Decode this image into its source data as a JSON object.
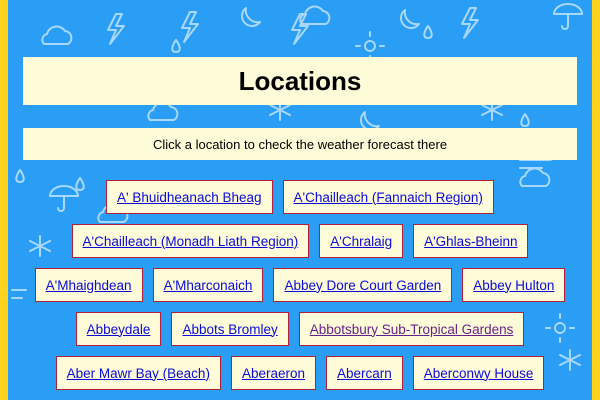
{
  "colors": {
    "background": "#2a9df4",
    "side_border": "#ffd21f",
    "panel": "#fdfbd8",
    "button_border": "#b21f3a",
    "link": "#0b0bd6",
    "visited_link": "#6b1f8a"
  },
  "background_icons": [
    "moon-icon",
    "cloud-icon",
    "lightning-icon",
    "raindrop-icon",
    "snowflake-icon",
    "umbrella-icon",
    "sun-icon",
    "wind-icon"
  ],
  "header": {
    "title": "Locations",
    "subtitle": "Click a location to check the weather forecast there"
  },
  "locations": {
    "rows": [
      [
        "A' Bhuidheanach Bheag",
        "A'Chailleach (Fannaich Region)"
      ],
      [
        "A'Chailleach (Monadh Liath Region)",
        "A'Chralaig",
        "A'Ghlas-Bheinn"
      ],
      [
        "A'Mhaighdean",
        "A'Mharconaich",
        "Abbey Dore Court Garden",
        "Abbey Hulton"
      ],
      [
        "Abbeydale",
        "Abbots Bromley",
        "Abbotsbury Sub-Tropical Gardens"
      ],
      [
        "Aber Mawr Bay (Beach)",
        "Aberaeron",
        "Abercarn",
        "Aberconwy House"
      ]
    ],
    "visited": [
      "Abbotsbury Sub-Tropical Gardens"
    ]
  }
}
